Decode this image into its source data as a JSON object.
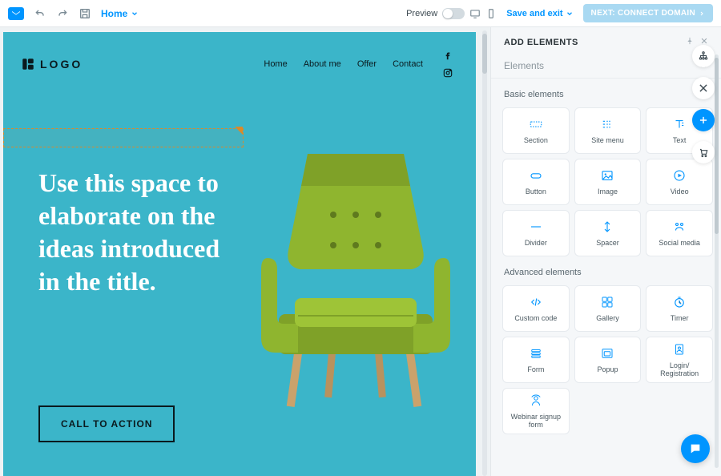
{
  "topbar": {
    "home_label": "Home",
    "preview_label": "Preview",
    "save_exit_label": "Save and exit",
    "next_label": "NEXT: CONNECT DOMAIN"
  },
  "canvas": {
    "logo_text": "LOGO",
    "nav": [
      "Home",
      "About me",
      "Offer",
      "Contact"
    ],
    "hero_text": "Use this space to elaborate on the ideas introduced in the title.",
    "cta_label": "CALL TO ACTION"
  },
  "panel": {
    "title": "ADD ELEMENTS",
    "section_label": "Elements",
    "groups": [
      {
        "label": "Basic elements",
        "items": [
          {
            "icon": "section",
            "label": "Section"
          },
          {
            "icon": "menu",
            "label": "Site menu"
          },
          {
            "icon": "text",
            "label": "Text"
          },
          {
            "icon": "button",
            "label": "Button"
          },
          {
            "icon": "image",
            "label": "Image"
          },
          {
            "icon": "video",
            "label": "Video"
          },
          {
            "icon": "divider",
            "label": "Divider"
          },
          {
            "icon": "spacer",
            "label": "Spacer"
          },
          {
            "icon": "social",
            "label": "Social media"
          }
        ]
      },
      {
        "label": "Advanced elements",
        "items": [
          {
            "icon": "code",
            "label": "Custom code"
          },
          {
            "icon": "gallery",
            "label": "Gallery"
          },
          {
            "icon": "timer",
            "label": "Timer"
          },
          {
            "icon": "form",
            "label": "Form"
          },
          {
            "icon": "popup",
            "label": "Popup"
          },
          {
            "icon": "login",
            "label": "Login/ Registration"
          },
          {
            "icon": "webinar",
            "label": "Webinar signup form"
          }
        ]
      }
    ]
  }
}
